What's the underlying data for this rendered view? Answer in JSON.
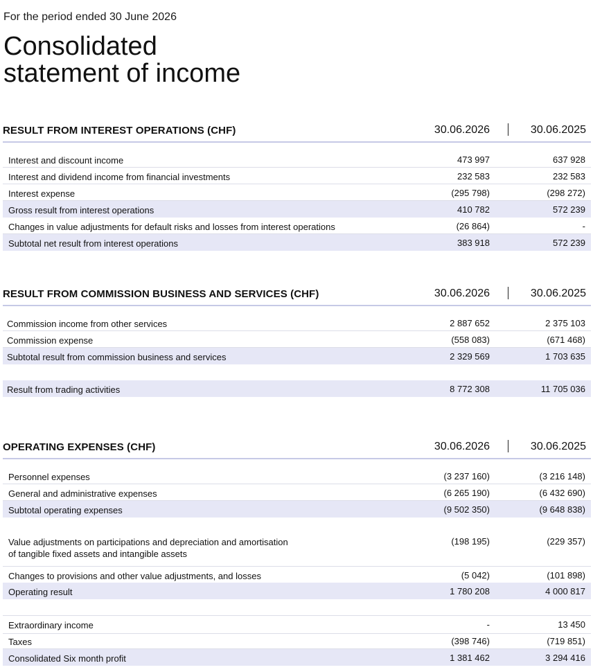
{
  "page": {
    "period": "For the period ended 30 June 2026",
    "title_line1": "Consolidated",
    "title_line2": "statement of income"
  },
  "sections": {
    "interest": {
      "title": "RESULT FROM INTEREST OPERATIONS (CHF)",
      "col1": "30.06.2026",
      "col2": "30.06.2025",
      "rows": [
        {
          "label": "Interest and discount income",
          "v1": "473 997",
          "v2": "637 928"
        },
        {
          "label": "Interest and dividend income from financial investments",
          "v1": "232 583",
          "v2": "232 583"
        },
        {
          "label": "Interest expense",
          "v1": "(295 798)",
          "v2": "(298 272)"
        },
        {
          "label": "Gross result from interest operations",
          "v1": "410 782",
          "v2": "572 239"
        },
        {
          "label": "Changes in value adjustments for default risks and losses from interest operations",
          "v1": "(26 864)",
          "v2": "-"
        },
        {
          "label": "Subtotal net result from interest operations",
          "v1": "383 918",
          "v2": "572 239"
        }
      ]
    },
    "commission": {
      "title": "RESULT FROM COMMISSION BUSINESS AND SERVICES (CHF)",
      "col1": "30.06.2026",
      "col2": "30.06.2025",
      "rows": [
        {
          "label": "Commission income from other services",
          "v1": "2 887 652",
          "v2": "2 375 103"
        },
        {
          "label": "Commission expense",
          "v1": "(558 083)",
          "v2": "(671 468)"
        },
        {
          "label": "Subtotal result from commission business and services",
          "v1": "2 329 569",
          "v2": "1 703 635"
        },
        {
          "label": "Result from trading activities",
          "v1": "8 772 308",
          "v2": "11 705 036"
        }
      ]
    },
    "opex": {
      "title": "OPERATING EXPENSES (CHF)",
      "col1": "30.06.2026",
      "col2": "30.06.2025",
      "rows": [
        {
          "label": "Personnel expenses",
          "v1": "(3 237 160)",
          "v2": "(3 216 148)"
        },
        {
          "label": "General and administrative expenses",
          "v1": "(6 265 190)",
          "v2": "(6 432 690)"
        },
        {
          "label": "Subtotal operating expenses",
          "v1": "(9 502 350)",
          "v2": "(9 648 838)"
        },
        {
          "label": "Value adjustments on participations and depreciation and amortisation",
          "label2": "of tangible fixed assets and intangible assets",
          "v1": "(198 195)",
          "v2": "(229 357)"
        },
        {
          "label": "Changes to provisions and other value adjustments, and losses",
          "v1": "(5 042)",
          "v2": "(101 898)"
        },
        {
          "label": "Operating result",
          "v1": "1 780 208",
          "v2": "4 000 817"
        },
        {
          "label": "Extraordinary income",
          "v1": "-",
          "v2": "13 450"
        },
        {
          "label": "Taxes",
          "v1": "(398 746)",
          "v2": "(719 851)"
        },
        {
          "label": "Consolidated Six month profit",
          "v1": "1 381 462",
          "v2": "3 294 416"
        }
      ]
    }
  }
}
